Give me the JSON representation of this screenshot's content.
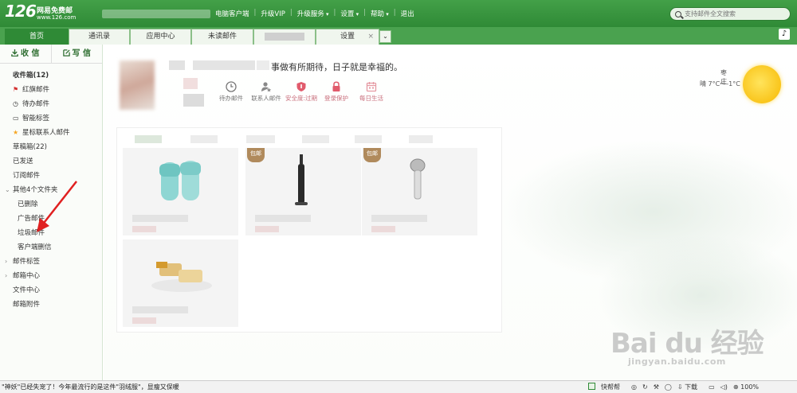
{
  "header": {
    "logo_number": "126",
    "logo_tagline": "网易免费邮",
    "logo_domain": "www.126.com",
    "nav": [
      {
        "label": "电脑客户端",
        "dropdown": false
      },
      {
        "label": "升级VIP",
        "dropdown": false
      },
      {
        "label": "升级服务",
        "dropdown": true
      },
      {
        "label": "设置",
        "dropdown": true
      },
      {
        "label": "帮助",
        "dropdown": true
      },
      {
        "label": "退出",
        "dropdown": false
      }
    ],
    "search_placeholder": "支持邮件全文搜索"
  },
  "tabs": [
    {
      "label": "首页",
      "active": true
    },
    {
      "label": "通讯录"
    },
    {
      "label": "应用中心"
    },
    {
      "label": "未读邮件"
    },
    {
      "label": ""
    },
    {
      "label": "设置",
      "closable": true
    }
  ],
  "sidebar": {
    "receive_label": "收 信",
    "write_label": "写 信",
    "items": [
      {
        "label": "收件箱",
        "count": "(12)"
      },
      {
        "label": "红旗邮件"
      },
      {
        "label": "待办邮件"
      },
      {
        "label": "智能标签"
      },
      {
        "label": "星标联系人邮件"
      },
      {
        "label": "草稿箱",
        "count": "(22)"
      },
      {
        "label": "已发送"
      },
      {
        "label": "订阅邮件"
      },
      {
        "label": "其他4个文件夹"
      },
      {
        "label": "已删除"
      },
      {
        "label": "广告邮件"
      },
      {
        "label": "垃圾邮件"
      },
      {
        "label": "客户端删信"
      },
      {
        "label": "邮件标签"
      },
      {
        "label": "邮箱中心"
      },
      {
        "label": "文件中心"
      },
      {
        "label": "邮箱附件"
      }
    ]
  },
  "main": {
    "greeting": "事做有所期待，日子就是幸福的。",
    "quick_icons": [
      {
        "label": "待办邮件",
        "icon": "clock-icon"
      },
      {
        "label": "联系人邮件",
        "icon": "contact-star-icon"
      },
      {
        "label": "安全度:过期",
        "icon": "shield-icon"
      },
      {
        "label": "登录保护",
        "icon": "lock-icon"
      },
      {
        "label": "每日生活",
        "icon": "calendar-icon"
      }
    ],
    "weather": {
      "city": "枣庄",
      "temp": "晴 7°C～-1°C"
    },
    "products": [
      {
        "name": "slippers",
        "badge": ""
      },
      {
        "name": "toothbrush",
        "badge": "包邮"
      },
      {
        "name": "shower-head",
        "badge": "包邮"
      },
      {
        "name": "pastry",
        "badge": ""
      }
    ]
  },
  "watermark": {
    "main": "Bai du 经验",
    "sub": "jingyan.baidu.com"
  },
  "statusbar": {
    "news": "\"神妖\"已经失宠了！今年最流行的是这件\"羽绒服\"，显瘦又保暖",
    "quick_help": "快帮帮",
    "download": "下载",
    "zoom": "100%"
  },
  "colors": {
    "brand_green": "#2f8a36",
    "header_green": "#43a048"
  }
}
